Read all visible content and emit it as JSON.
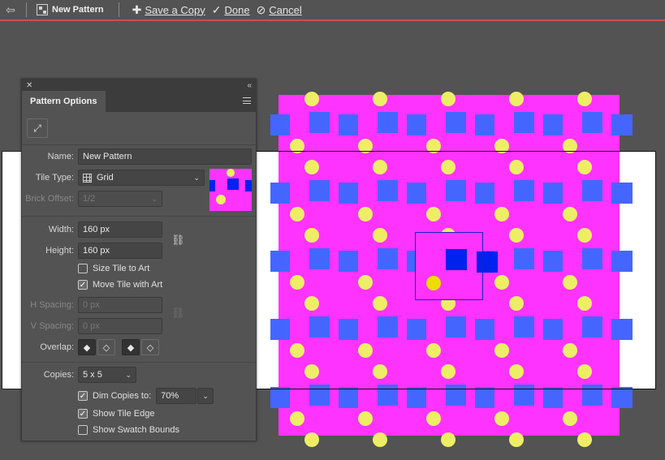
{
  "topbar": {
    "back_icon": "back-arrow-icon",
    "pattern_name": "New Pattern",
    "save_copy_label": "Save a Copy",
    "done_label": "Done",
    "cancel_label": "Cancel"
  },
  "panel": {
    "tab_title": "Pattern Options",
    "name_label": "Name:",
    "name_value": "New Pattern",
    "tile_type_label": "Tile Type:",
    "tile_type_value": "Grid",
    "brick_offset_label": "Brick Offset:",
    "brick_offset_value": "1/2",
    "width_label": "Width:",
    "width_value": "160 px",
    "height_label": "Height:",
    "height_value": "160 px",
    "size_tile_label": "Size Tile to Art",
    "size_tile_checked": false,
    "move_tile_label": "Move Tile with Art",
    "move_tile_checked": true,
    "hspacing_label": "H Spacing:",
    "hspacing_value": "0 px",
    "vspacing_label": "V Spacing:",
    "vspacing_value": "0 px",
    "overlap_label": "Overlap:",
    "copies_label": "Copies:",
    "copies_value": "5 x 5",
    "dim_copies_label": "Dim Copies to:",
    "dim_copies_checked": true,
    "dim_copies_value": "70%",
    "show_tile_edge_label": "Show Tile Edge",
    "show_tile_edge_checked": true,
    "show_swatch_bounds_label": "Show Swatch Bounds",
    "show_swatch_bounds_checked": false
  },
  "colors": {
    "magenta": "#ff33ff",
    "blue_square": "#4466ff",
    "yellow_dot": "#eeee66",
    "tile_edge": "#1a22cc"
  }
}
